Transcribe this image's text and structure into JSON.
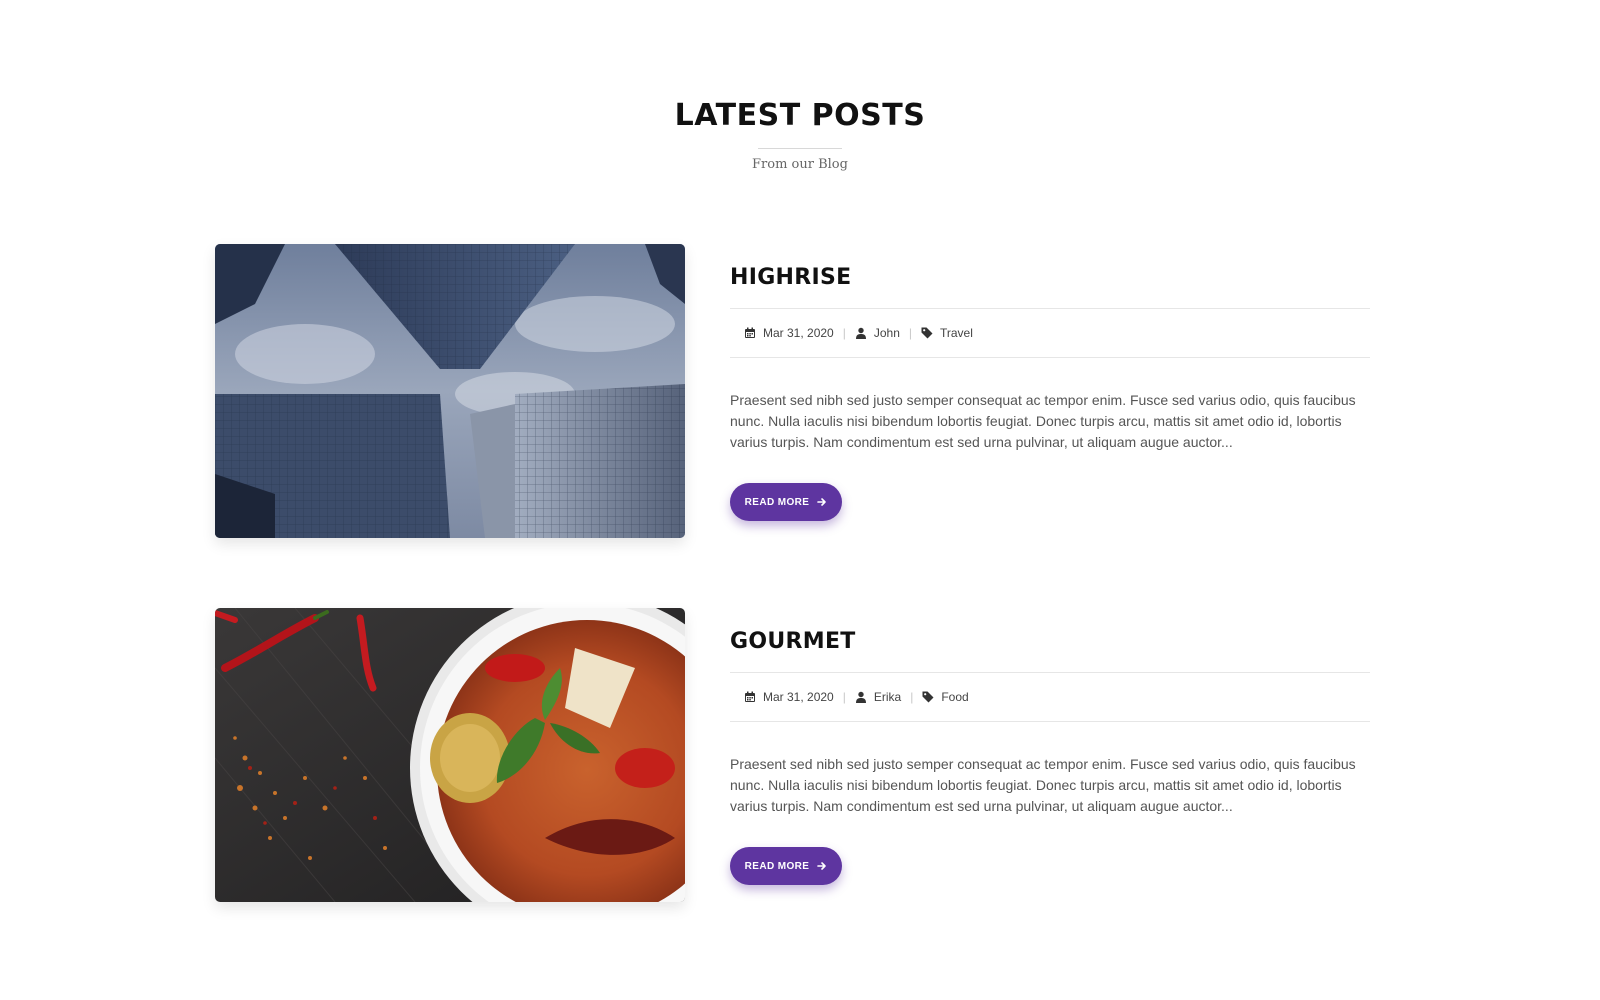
{
  "section": {
    "title": "LATEST POSTS",
    "subtitle": "From our Blog"
  },
  "posts": [
    {
      "title": "HIGHRISE",
      "date": "Mar 31, 2020",
      "author": "John",
      "category": "Travel",
      "excerpt": "Praesent sed nibh sed justo semper consequat ac tempor enim. Fusce sed varius odio, quis faucibus nunc. Nulla iaculis nisi bibendum lobortis feugiat. Donec turpis arcu, mattis sit amet odio id, lobortis varius turpis. Nam condimentum est sed urna pulvinar, ut aliquam augue auctor...",
      "button": "READ MORE",
      "image": "skyscrapers-photo"
    },
    {
      "title": "GOURMET",
      "date": "Mar 31, 2020",
      "author": "Erika",
      "category": "Food",
      "excerpt": "Praesent sed nibh sed justo semper consequat ac tempor enim. Fusce sed varius odio, quis faucibus nunc. Nulla iaculis nisi bibendum lobortis feugiat. Donec turpis arcu, mattis sit amet odio id, lobortis varius turpis. Nam condimentum est sed urna pulvinar, ut aliquam augue auctor...",
      "button": "READ MORE",
      "image": "curry-bowl-photo"
    }
  ],
  "icons": {
    "date": "calendar-icon",
    "author": "user-icon",
    "category": "tag-icon",
    "button": "arrow-right-icon"
  },
  "colors": {
    "accent": "#5e35a0",
    "title": "#111111",
    "text": "#555555"
  }
}
